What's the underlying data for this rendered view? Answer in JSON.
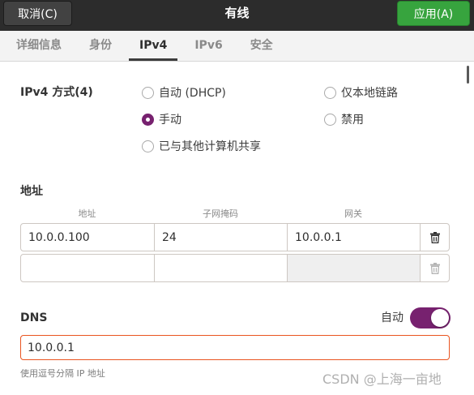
{
  "window": {
    "title": "有线",
    "cancel_label": "取消(C)",
    "apply_label": "应用(A)"
  },
  "tabs": [
    {
      "label": "详细信息",
      "selected": false
    },
    {
      "label": "身份",
      "selected": false
    },
    {
      "label": "IPv4",
      "selected": true
    },
    {
      "label": "IPv6",
      "selected": false
    },
    {
      "label": "安全",
      "selected": false
    }
  ],
  "ipv4": {
    "method_label": "IPv4 方式(4)",
    "methods": [
      {
        "label": "自动 (DHCP)",
        "checked": false
      },
      {
        "label": "手动",
        "checked": true
      },
      {
        "label": "已与其他计算机共享",
        "checked": false
      },
      {
        "label": "仅本地链路",
        "checked": false
      },
      {
        "label": "禁用",
        "checked": false
      }
    ]
  },
  "addresses": {
    "heading": "地址",
    "columns": [
      "地址",
      "子网掩码",
      "网关"
    ],
    "rows": [
      {
        "address": "10.0.0.100",
        "netmask": "24",
        "gateway": "10.0.0.1",
        "gateway_editable": true,
        "delete_enabled": true
      },
      {
        "address": "",
        "netmask": "",
        "gateway": "",
        "gateway_editable": false,
        "delete_enabled": false
      }
    ]
  },
  "dns": {
    "label": "DNS",
    "auto_label": "自动",
    "auto_enabled": true,
    "servers": "10.0.0.1",
    "hint": "使用逗号分隔 IP 地址"
  },
  "icons": {
    "delete_row": "trash-icon"
  },
  "colors": {
    "titlebar": "#2c2c2c",
    "apply_button": "#37a43e",
    "accent": "#77216f",
    "focus_border": "#e95420",
    "tab_indicator": "#3c3c3c"
  },
  "watermark": "CSDN @上海一亩地"
}
